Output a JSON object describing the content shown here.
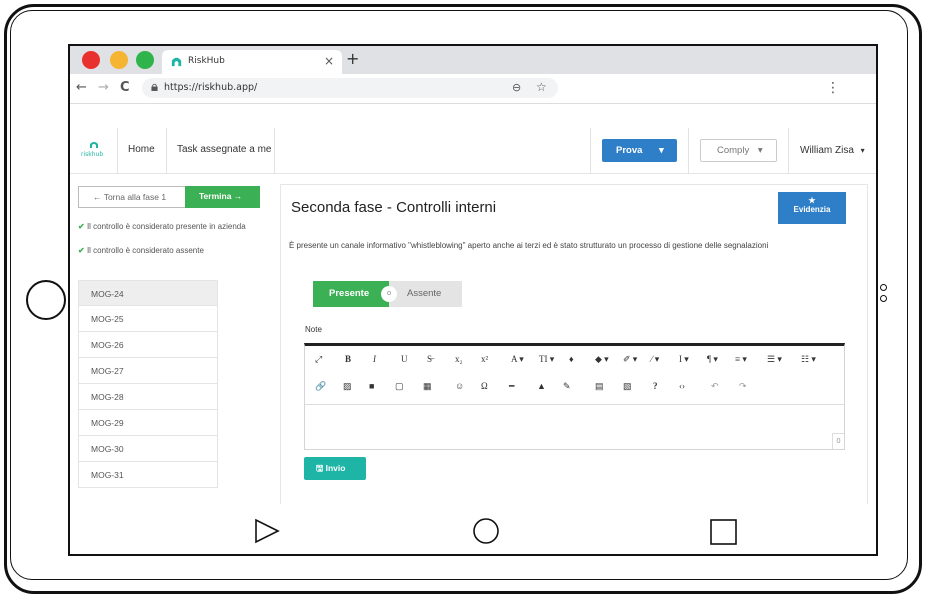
{
  "browser": {
    "tab_title": "RiskHub",
    "tab_close": "×",
    "new_tab": "+",
    "url": "https://riskhub.app/",
    "back": "←",
    "forward": "→",
    "reload": "C",
    "zoom": "⊖",
    "bookmark": "☆",
    "menu": "⋮",
    "traffic_colors": [
      "#e8312f",
      "#f5b431",
      "#2fb34b"
    ]
  },
  "nav": {
    "logo_text": "riskhub",
    "home": "Home",
    "tasks": "Task assegnate a me",
    "prova": "Prova",
    "comply": "Comply",
    "user": "William Zisa",
    "caret": "▾"
  },
  "sidebar": {
    "back_label": "← Torna alla fase 1",
    "finish_label": "Termina →",
    "legend": [
      {
        "check": "✔",
        "text": "Il controllo è considerato presente in azienda"
      },
      {
        "check": "✔",
        "text": "Il controllo è considerato assente"
      }
    ],
    "items": [
      "MOG-24",
      "MOG-25",
      "MOG-26",
      "MOG-27",
      "MOG-28",
      "MOG-29",
      "MOG-30",
      "MOG-31"
    ]
  },
  "main": {
    "title": "Seconda fase - Controlli interni",
    "evidence_icon": "★",
    "evidence_label": "Evidenzia",
    "question": "È presente un canale informativo \"whistleblowing\" aperto anche ai terzi ed è stato strutturato un processo di gestione delle segnalazioni",
    "toggle_on": "Presente",
    "toggle_off": "Assente",
    "toggle_knob": "o",
    "notes_label": "Note",
    "char_count": "0",
    "send_label": "🖫 Invio"
  },
  "toolbar": {
    "row1": [
      "⤢",
      "B",
      "I",
      "U",
      "S̶",
      "x₂",
      "x²",
      "A ▾",
      "TI ▾",
      "♦",
      "◆ ▾",
      "✐ ▾",
      "⁄ ▾",
      "I ▾",
      "¶ ▾",
      "≡ ▾",
      "☰ ▾",
      "☷ ▾"
    ],
    "row2": [
      "🔗",
      "▨",
      "■",
      "▢",
      "▦",
      "☺",
      "Ω",
      "━",
      "▲",
      "✎",
      "▤",
      "▧",
      "?",
      "‹›",
      "↶",
      "↷"
    ]
  },
  "colors": {
    "primary": "#2f7fc8",
    "success": "#3cb054",
    "teal": "#1fb5a6"
  }
}
